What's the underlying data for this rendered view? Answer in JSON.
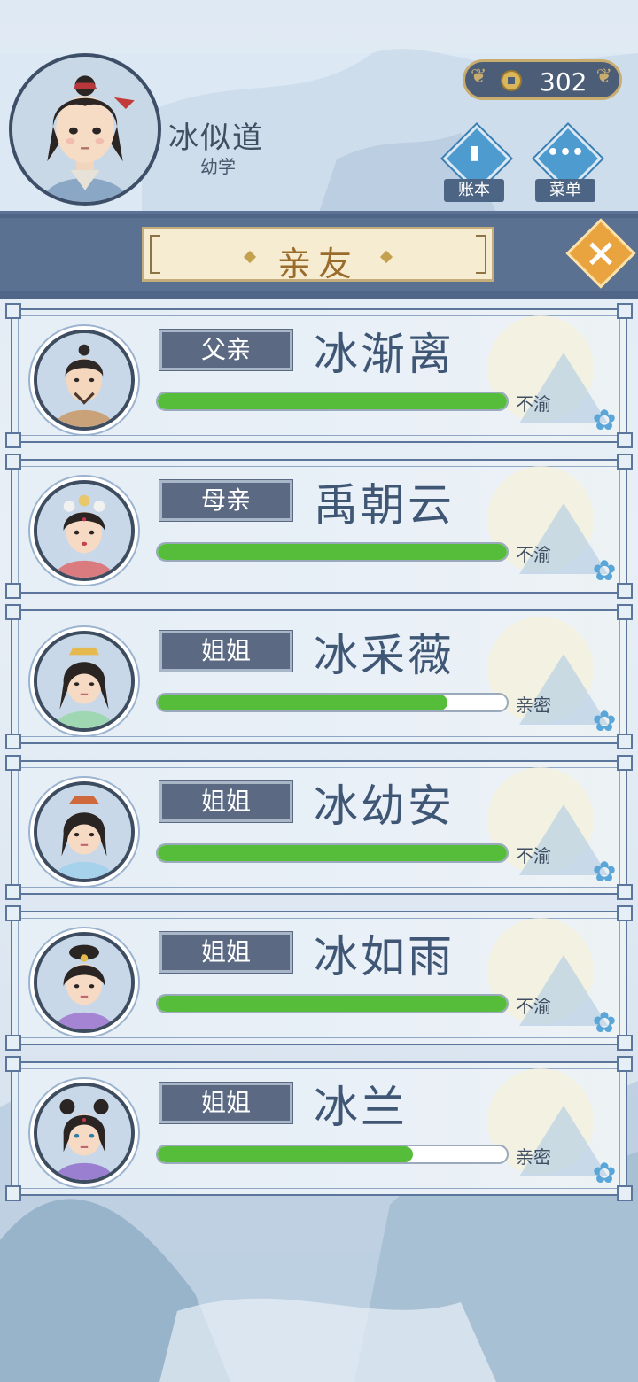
{
  "player": {
    "name": "冰似道",
    "rank": "幼学"
  },
  "currency": {
    "coins": "302",
    "icon": "coin-icon"
  },
  "top_buttons": [
    {
      "label": "账本",
      "icon": "ledger-icon"
    },
    {
      "label": "菜单",
      "icon": "menu-dots-icon"
    }
  ],
  "page": {
    "title": "亲友",
    "close_icon": "close-icon"
  },
  "relatives": [
    {
      "relation": "父亲",
      "name": "冰渐离",
      "affinity": 1.0,
      "status": "不渝"
    },
    {
      "relation": "母亲",
      "name": "禹朝云",
      "affinity": 1.0,
      "status": "不渝"
    },
    {
      "relation": "姐姐",
      "name": "冰采薇",
      "affinity": 0.83,
      "status": "亲密"
    },
    {
      "relation": "姐姐",
      "name": "冰幼安",
      "affinity": 1.0,
      "status": "不渝"
    },
    {
      "relation": "姐姐",
      "name": "冰如雨",
      "affinity": 1.0,
      "status": "不渝"
    },
    {
      "relation": "姐姐",
      "name": "冰兰",
      "affinity": 0.73,
      "status": "亲密"
    }
  ],
  "colors": {
    "affinity_bar": "#55bd3a",
    "header_bar": "#5a7192",
    "accent_gold": "#c9ad6f"
  }
}
